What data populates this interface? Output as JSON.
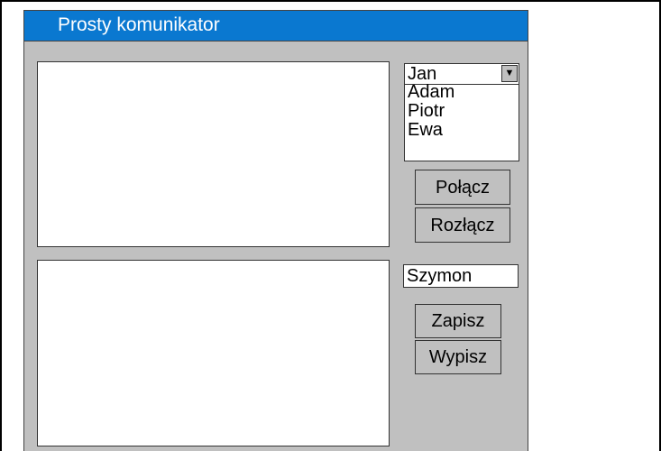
{
  "window": {
    "title": "Prosty komunikator"
  },
  "chat_log": {
    "value": ""
  },
  "message_box": {
    "value": ""
  },
  "user_select": {
    "selected": "Jan",
    "arrow": "▼",
    "options": [
      "Adam",
      "Piotr",
      "Ewa"
    ]
  },
  "connection": {
    "connect_label": "Połącz",
    "disconnect_label": "Rozłącz"
  },
  "registration": {
    "name_value": "Szymon",
    "save_label": "Zapisz",
    "unsave_label": "Wypisz"
  },
  "colors": {
    "titlebar": "#0a78d0",
    "window_bg": "#c0c0c0"
  }
}
